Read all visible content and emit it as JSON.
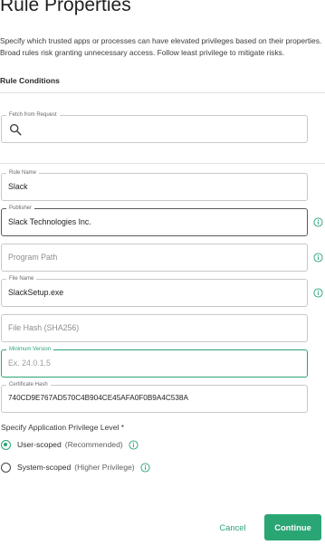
{
  "page": {
    "title": "Rule Properties",
    "description": "Specify which trusted apps or processes can have elevated privileges based on their properties. Broad rules risk granting unnecessary access. Follow least privilege to mitigate risks.",
    "section_title": "Rule Conditions"
  },
  "fetch": {
    "label": "Fetch from Request",
    "value": ""
  },
  "fields": {
    "rule_name": {
      "label": "Rule Name",
      "value": "Slack"
    },
    "publisher": {
      "label": "Publisher",
      "value": "Slack Technologies Inc."
    },
    "program_path": {
      "placeholder": "Program Path"
    },
    "file_name": {
      "label": "File Name",
      "value": "SlackSetup.exe"
    },
    "file_hash": {
      "placeholder": "File Hash (SHA256)"
    },
    "minimum_version": {
      "label": "Minimum Version",
      "placeholder": "Ex. 24.0.1.5"
    },
    "certificate_hash": {
      "label": "Certificate Hash",
      "value": "740CD9E767AD570C4B904CE45AFA0F0B9A4C538A"
    }
  },
  "privilege": {
    "label": "Specify Application Privilege Level *",
    "options": [
      {
        "label": "User-scoped",
        "hint": "(Recommended)",
        "selected": true
      },
      {
        "label": "System-scoped",
        "hint": "(Higher Privilege)",
        "selected": false
      }
    ]
  },
  "actions": {
    "cancel": "Cancel",
    "continue": "Continue"
  },
  "colors": {
    "accent": "#2aa574",
    "text": "#2b2b2b",
    "border": "#c9c9c9"
  },
  "icons": {
    "search": "search-icon",
    "info": "info-icon"
  }
}
